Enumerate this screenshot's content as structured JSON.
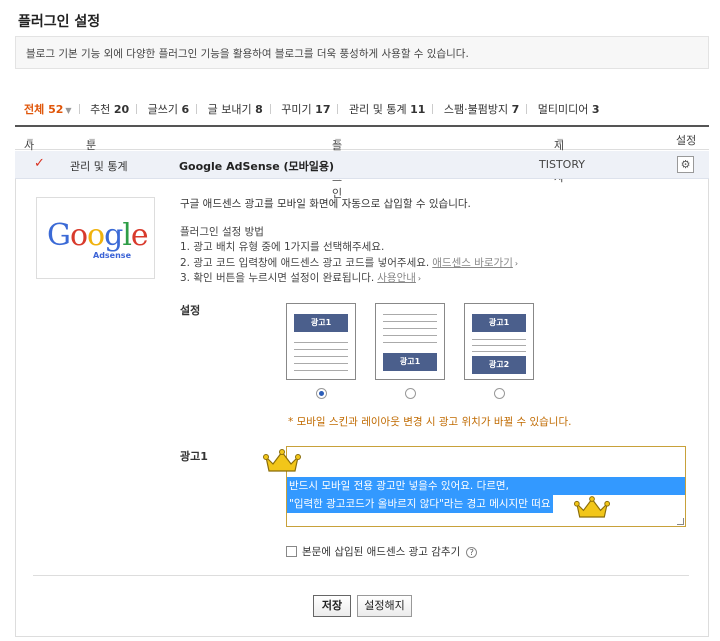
{
  "page": {
    "title": "플러그인 설정",
    "description": "블로그 기본 기능 외에 다양한 플러그인 기능을 활용하여 블로그를 더욱 풍성하게 사용할 수 있습니다."
  },
  "tabs": [
    {
      "label": "전체",
      "count": "52"
    },
    {
      "label": "추천",
      "count": "20"
    },
    {
      "label": "글쓰기",
      "count": "6"
    },
    {
      "label": "글 보내기",
      "count": "8"
    },
    {
      "label": "꾸미기",
      "count": "17"
    },
    {
      "label": "관리 및 통계",
      "count": "11"
    },
    {
      "label": "스팸·불펌방지",
      "count": "7"
    },
    {
      "label": "멀티미디어",
      "count": "3"
    }
  ],
  "grid": {
    "headers": {
      "use": "사용",
      "category": "분류",
      "plugin": "플러그인",
      "author": "제작자",
      "settings": "설정"
    }
  },
  "plugin": {
    "category": "관리 및 통계",
    "name": "Google AdSense (모바일용)",
    "author": "TISTORY",
    "logo_text": "Google",
    "logo_sub": "Adsense",
    "intro": "구글 애드센스 광고를 모바일 화면에 자동으로 삽입할 수 있습니다.",
    "howto_title": "플러그인 설정 방법",
    "step1": "1. 광고 배치 유형 중에 1가지를 선택해주세요.",
    "step2": "2. 광고 코드 입력창에 애드센스 광고 코드를 넣어주세요.",
    "step2_link": "애드센스 바로가기",
    "step3": "3. 확인 버튼을 누르시면 설정이 완료됩니다.",
    "step3_link": "사용안내"
  },
  "settings": {
    "label": "설정",
    "layout_ad1": "광고1",
    "layout_ad2": "광고2",
    "selected_layout": 1,
    "notice": "* 모바일 스킨과 레이아웃 변경 시 광고 위치가 바뀔 수 있습니다.",
    "ad1_label": "광고1",
    "ad1_text_line1": "반드시 모바일 전용 광고만 넣을수 있어요. 다르면,",
    "ad1_text_line2": "\"입력한 광고코드가 올바르지 않다\"라는 경고 메시지만 떠요",
    "hide_checkbox_label": "본문에 삽입된 애드센스 광고 감추기",
    "hide_checked": false,
    "help": "?"
  },
  "buttons": {
    "save": "저장",
    "reset": "설정해지"
  },
  "colors": {
    "accent": "#e0560a",
    "ad_block": "#4b5f8c",
    "highlight": "#3399ff",
    "crown": "#f2c619"
  }
}
